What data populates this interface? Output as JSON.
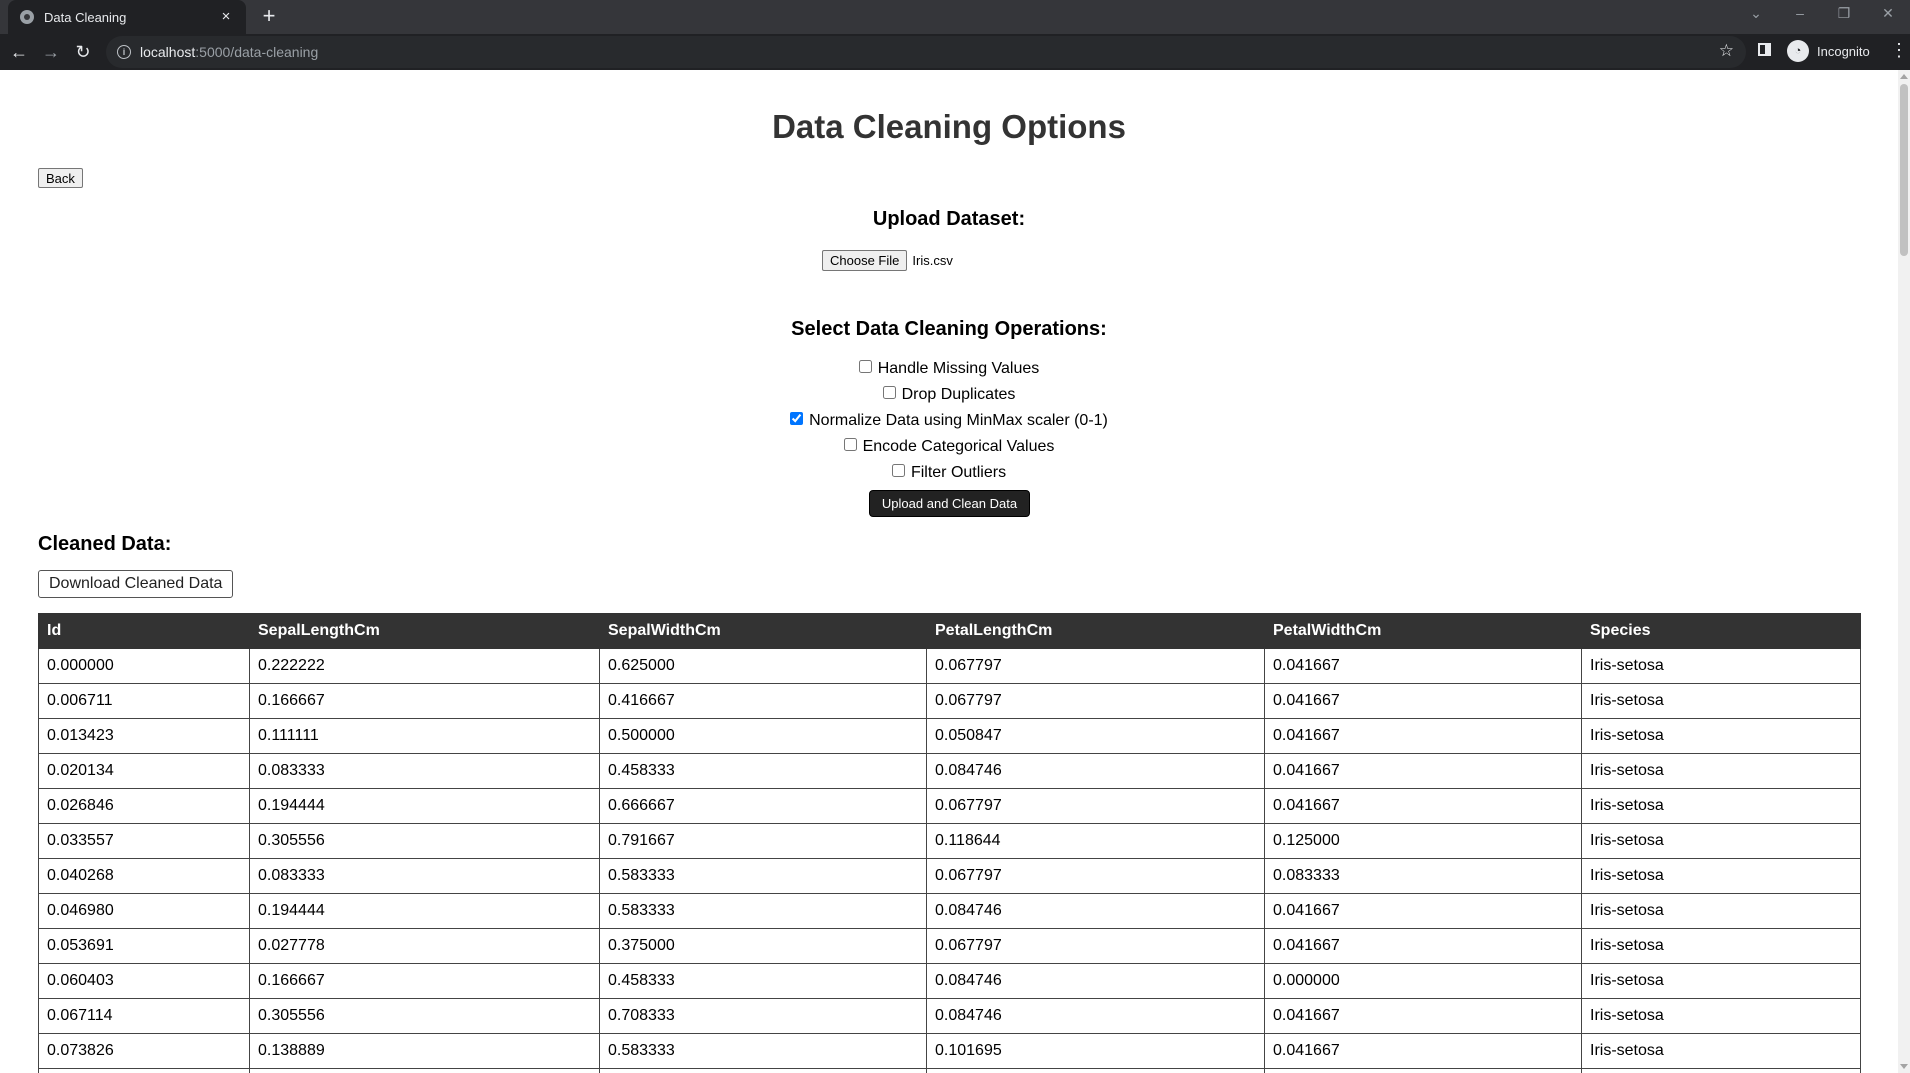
{
  "browser": {
    "tab_title": "Data Cleaning",
    "close_glyph": "×",
    "new_tab_glyph": "+",
    "url_host": "localhost",
    "url_path": ":5000/data-cleaning",
    "incognito_label": "Incognito",
    "icons": [
      "globe-icon",
      "close-icon",
      "plus-icon",
      "back-arrow-icon",
      "forward-arrow-icon",
      "reload-icon",
      "info-icon",
      "star-icon",
      "side-panel-icon",
      "incognito-icon",
      "kebab-menu-icon"
    ]
  },
  "page": {
    "title": "Data Cleaning Options",
    "back_label": "Back",
    "upload": {
      "heading": "Upload Dataset:",
      "choose_label": "Choose File",
      "file_name": "Iris.csv"
    },
    "ops": {
      "heading": "Select Data Cleaning Operations:",
      "options": [
        {
          "label": "Handle Missing Values",
          "checked": false
        },
        {
          "label": "Drop Duplicates",
          "checked": false
        },
        {
          "label": "Normalize Data using MinMax scaler (0-1)",
          "checked": true
        },
        {
          "label": "Encode Categorical Values",
          "checked": false
        },
        {
          "label": "Filter Outliers",
          "checked": false
        }
      ],
      "submit_label": "Upload and Clean Data"
    },
    "cleaned": {
      "heading": "Cleaned Data:",
      "download_label": "Download Cleaned Data"
    }
  },
  "table": {
    "columns": [
      "Id",
      "SepalLengthCm",
      "SepalWidthCm",
      "PetalLengthCm",
      "PetalWidthCm",
      "Species"
    ],
    "rows": [
      [
        "0.000000",
        "0.222222",
        "0.625000",
        "0.067797",
        "0.041667",
        "Iris-setosa"
      ],
      [
        "0.006711",
        "0.166667",
        "0.416667",
        "0.067797",
        "0.041667",
        "Iris-setosa"
      ],
      [
        "0.013423",
        "0.111111",
        "0.500000",
        "0.050847",
        "0.041667",
        "Iris-setosa"
      ],
      [
        "0.020134",
        "0.083333",
        "0.458333",
        "0.084746",
        "0.041667",
        "Iris-setosa"
      ],
      [
        "0.026846",
        "0.194444",
        "0.666667",
        "0.067797",
        "0.041667",
        "Iris-setosa"
      ],
      [
        "0.033557",
        "0.305556",
        "0.791667",
        "0.118644",
        "0.125000",
        "Iris-setosa"
      ],
      [
        "0.040268",
        "0.083333",
        "0.583333",
        "0.067797",
        "0.083333",
        "Iris-setosa"
      ],
      [
        "0.046980",
        "0.194444",
        "0.583333",
        "0.084746",
        "0.041667",
        "Iris-setosa"
      ],
      [
        "0.053691",
        "0.027778",
        "0.375000",
        "0.067797",
        "0.041667",
        "Iris-setosa"
      ],
      [
        "0.060403",
        "0.166667",
        "0.458333",
        "0.084746",
        "0.000000",
        "Iris-setosa"
      ],
      [
        "0.067114",
        "0.305556",
        "0.708333",
        "0.084746",
        "0.041667",
        "Iris-setosa"
      ],
      [
        "0.073826",
        "0.138889",
        "0.583333",
        "0.101695",
        "0.041667",
        "Iris-setosa"
      ],
      [
        "",
        "",
        "",
        "",
        "",
        ""
      ]
    ]
  }
}
